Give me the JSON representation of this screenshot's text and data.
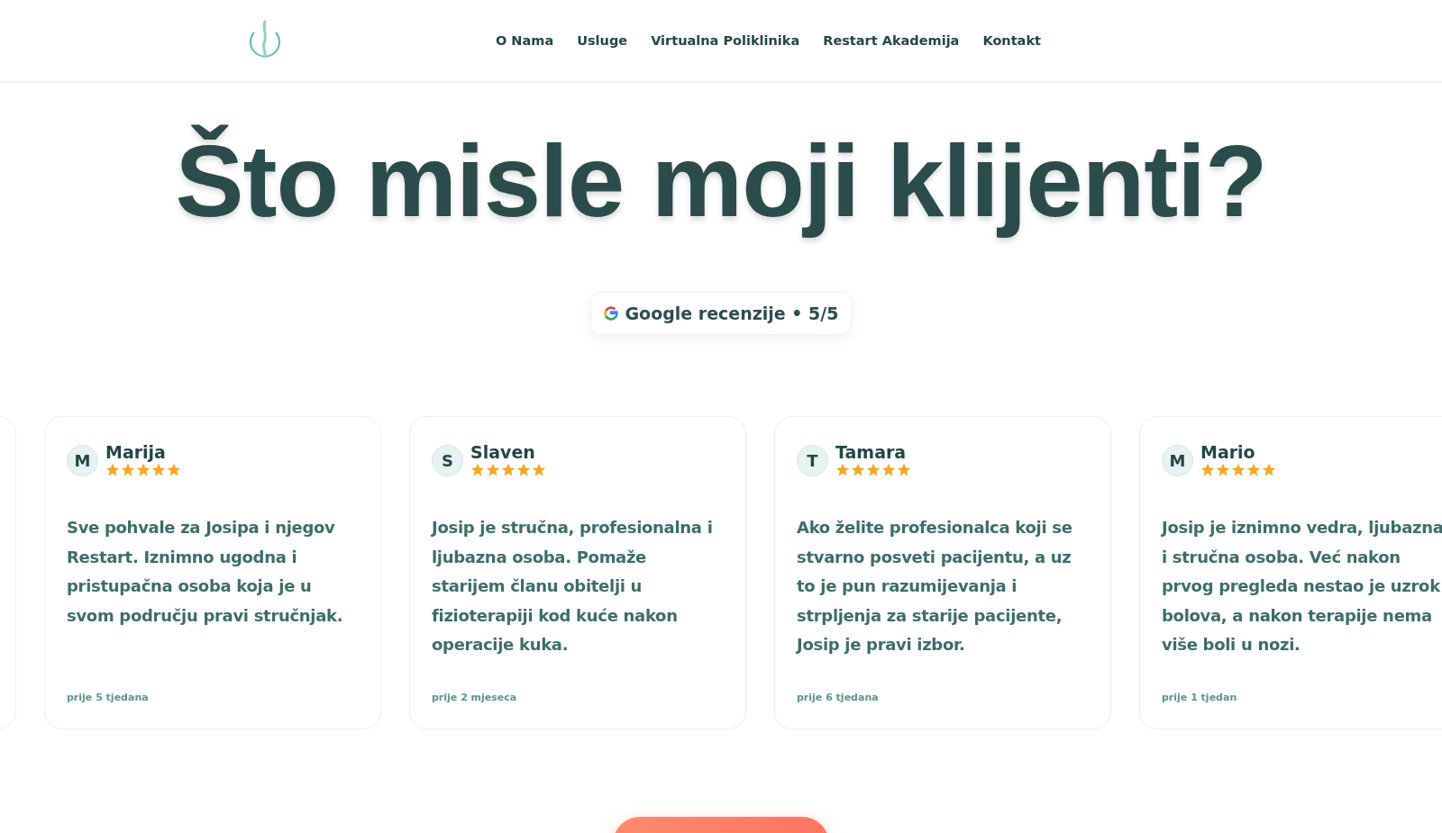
{
  "nav": {
    "items": [
      "O Nama",
      "Usluge",
      "Virtualna Poliklinika",
      "Restart Akademija",
      "Kontakt"
    ]
  },
  "heading": "Što misle moji klijenti?",
  "badge": {
    "text": "Google recenzije • 5/5"
  },
  "reviews": [
    {
      "initial": "M",
      "name": "Marija",
      "stars": 5,
      "text": "Sve pohvale za Josipa i njegov Restart. Iznimno ugodna i pristupačna osoba koja je u svom području pravi stručnjak.",
      "time": "prije 5 tjedana"
    },
    {
      "initial": "S",
      "name": "Slaven",
      "stars": 5,
      "text": "Josip je stručna, profesionalna i ljubazna osoba. Pomaže starijem članu obitelji u fizioterapiji kod kuće nakon operacije kuka.",
      "time": "prije 2 mjeseca"
    },
    {
      "initial": "T",
      "name": "Tamara",
      "stars": 5,
      "text": "Ako želite profesionalca koji se stvarno posveti pacijentu, a uz to je pun razumijevanja i strpljenja za starije pacijente, Josip je pravi izbor.",
      "time": "prije 6 tjedana"
    },
    {
      "initial": "M",
      "name": "Mario",
      "stars": 5,
      "text": "Josip je iznimno vedra, ljubazna i stručna osoba. Već nakon prvog pregleda nestao je uzrok bolova, a nakon terapije nema više boli u nozi.",
      "time": "prije 1 tjedan"
    }
  ]
}
